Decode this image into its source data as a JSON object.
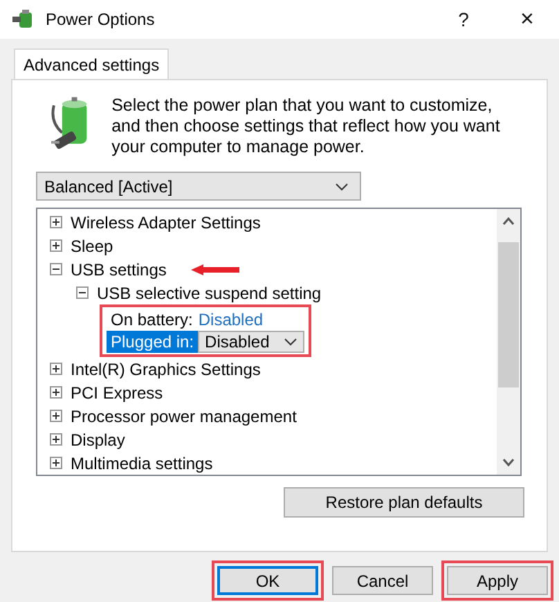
{
  "window": {
    "title": "Power Options",
    "help": "?",
    "close": "×"
  },
  "tabs": [
    {
      "label": "Advanced settings",
      "selected": true
    }
  ],
  "description": "Select the power plan that you want to customize, and then choose settings that reflect how you want your computer to manage power.",
  "plan_dropdown": {
    "value": "Balanced [Active]"
  },
  "tree": [
    {
      "label": "Wireless Adapter Settings",
      "expanded": false
    },
    {
      "label": "Sleep",
      "expanded": false
    },
    {
      "label": "USB settings",
      "expanded": true,
      "children": [
        {
          "label": "USB selective suspend setting",
          "expanded": true,
          "settings": [
            {
              "kind": "value",
              "label": "On battery:",
              "value": "Disabled",
              "selected": false
            },
            {
              "kind": "dropdown",
              "label": "Plugged in:",
              "value": "Disabled",
              "selected": true
            }
          ]
        }
      ]
    },
    {
      "label": "Intel(R) Graphics Settings",
      "expanded": false
    },
    {
      "label": "PCI Express",
      "expanded": false
    },
    {
      "label": "Processor power management",
      "expanded": false
    },
    {
      "label": "Display",
      "expanded": false
    },
    {
      "label": "Multimedia settings",
      "expanded": false
    }
  ],
  "restore_button": "Restore plan defaults",
  "buttons": [
    {
      "label": "OK",
      "default": true
    },
    {
      "label": "Cancel",
      "default": false
    },
    {
      "label": "Apply",
      "default": false
    }
  ]
}
